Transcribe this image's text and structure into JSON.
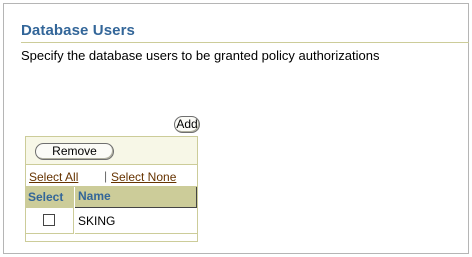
{
  "section": {
    "title": "Database Users",
    "description": "Specify the database users to be granted policy authorizations"
  },
  "buttons": {
    "add": "Add",
    "remove": "Remove"
  },
  "selection": {
    "select_all": "Select All",
    "separator": "|",
    "select_none": "Select None"
  },
  "table": {
    "columns": [
      "Select",
      "Name"
    ],
    "rows": [
      {
        "checked": false,
        "name": "SKING"
      }
    ]
  },
  "colors": {
    "title": "#336699",
    "header_bg": "#cccc99",
    "link": "#663300"
  }
}
